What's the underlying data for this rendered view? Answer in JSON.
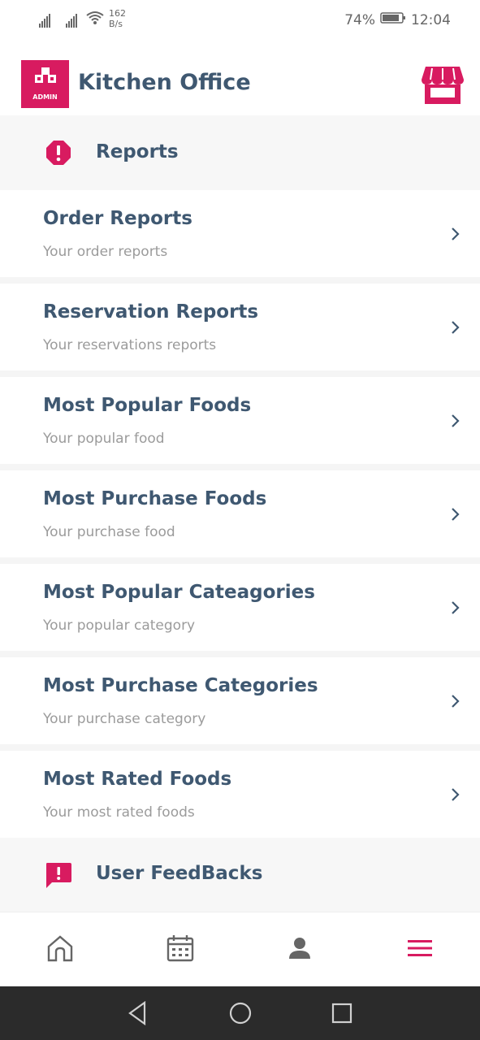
{
  "status_bar": {
    "speed_value": "162",
    "speed_unit": "B/s",
    "battery": "74%",
    "time": "12:04"
  },
  "header": {
    "logo_label": "ADMIN",
    "title": "Kitchen Office"
  },
  "sections": {
    "reports": "Reports",
    "feedbacks": "User FeedBacks"
  },
  "items": [
    {
      "title": "Order Reports",
      "subtitle": "Your order reports"
    },
    {
      "title": "Reservation Reports",
      "subtitle": "Your reservations reports"
    },
    {
      "title": "Most Popular Foods",
      "subtitle": "Your popular food"
    },
    {
      "title": "Most Purchase Foods",
      "subtitle": "Your purchase food"
    },
    {
      "title": "Most Popular Cateagories",
      "subtitle": "Your popular category"
    },
    {
      "title": "Most Purchase Categories",
      "subtitle": "Your purchase category"
    },
    {
      "title": "Most Rated Foods",
      "subtitle": "Your most rated foods"
    }
  ],
  "icons": {
    "reports": "alert-octagon-icon",
    "feedbacks": "feedback-icon",
    "store": "store-icon",
    "nav": [
      "home-icon",
      "calendar-icon",
      "person-icon",
      "menu-icon"
    ]
  },
  "colors": {
    "accent": "#d81b60",
    "text": "#3f5871",
    "subtext": "#9b9b9b"
  }
}
